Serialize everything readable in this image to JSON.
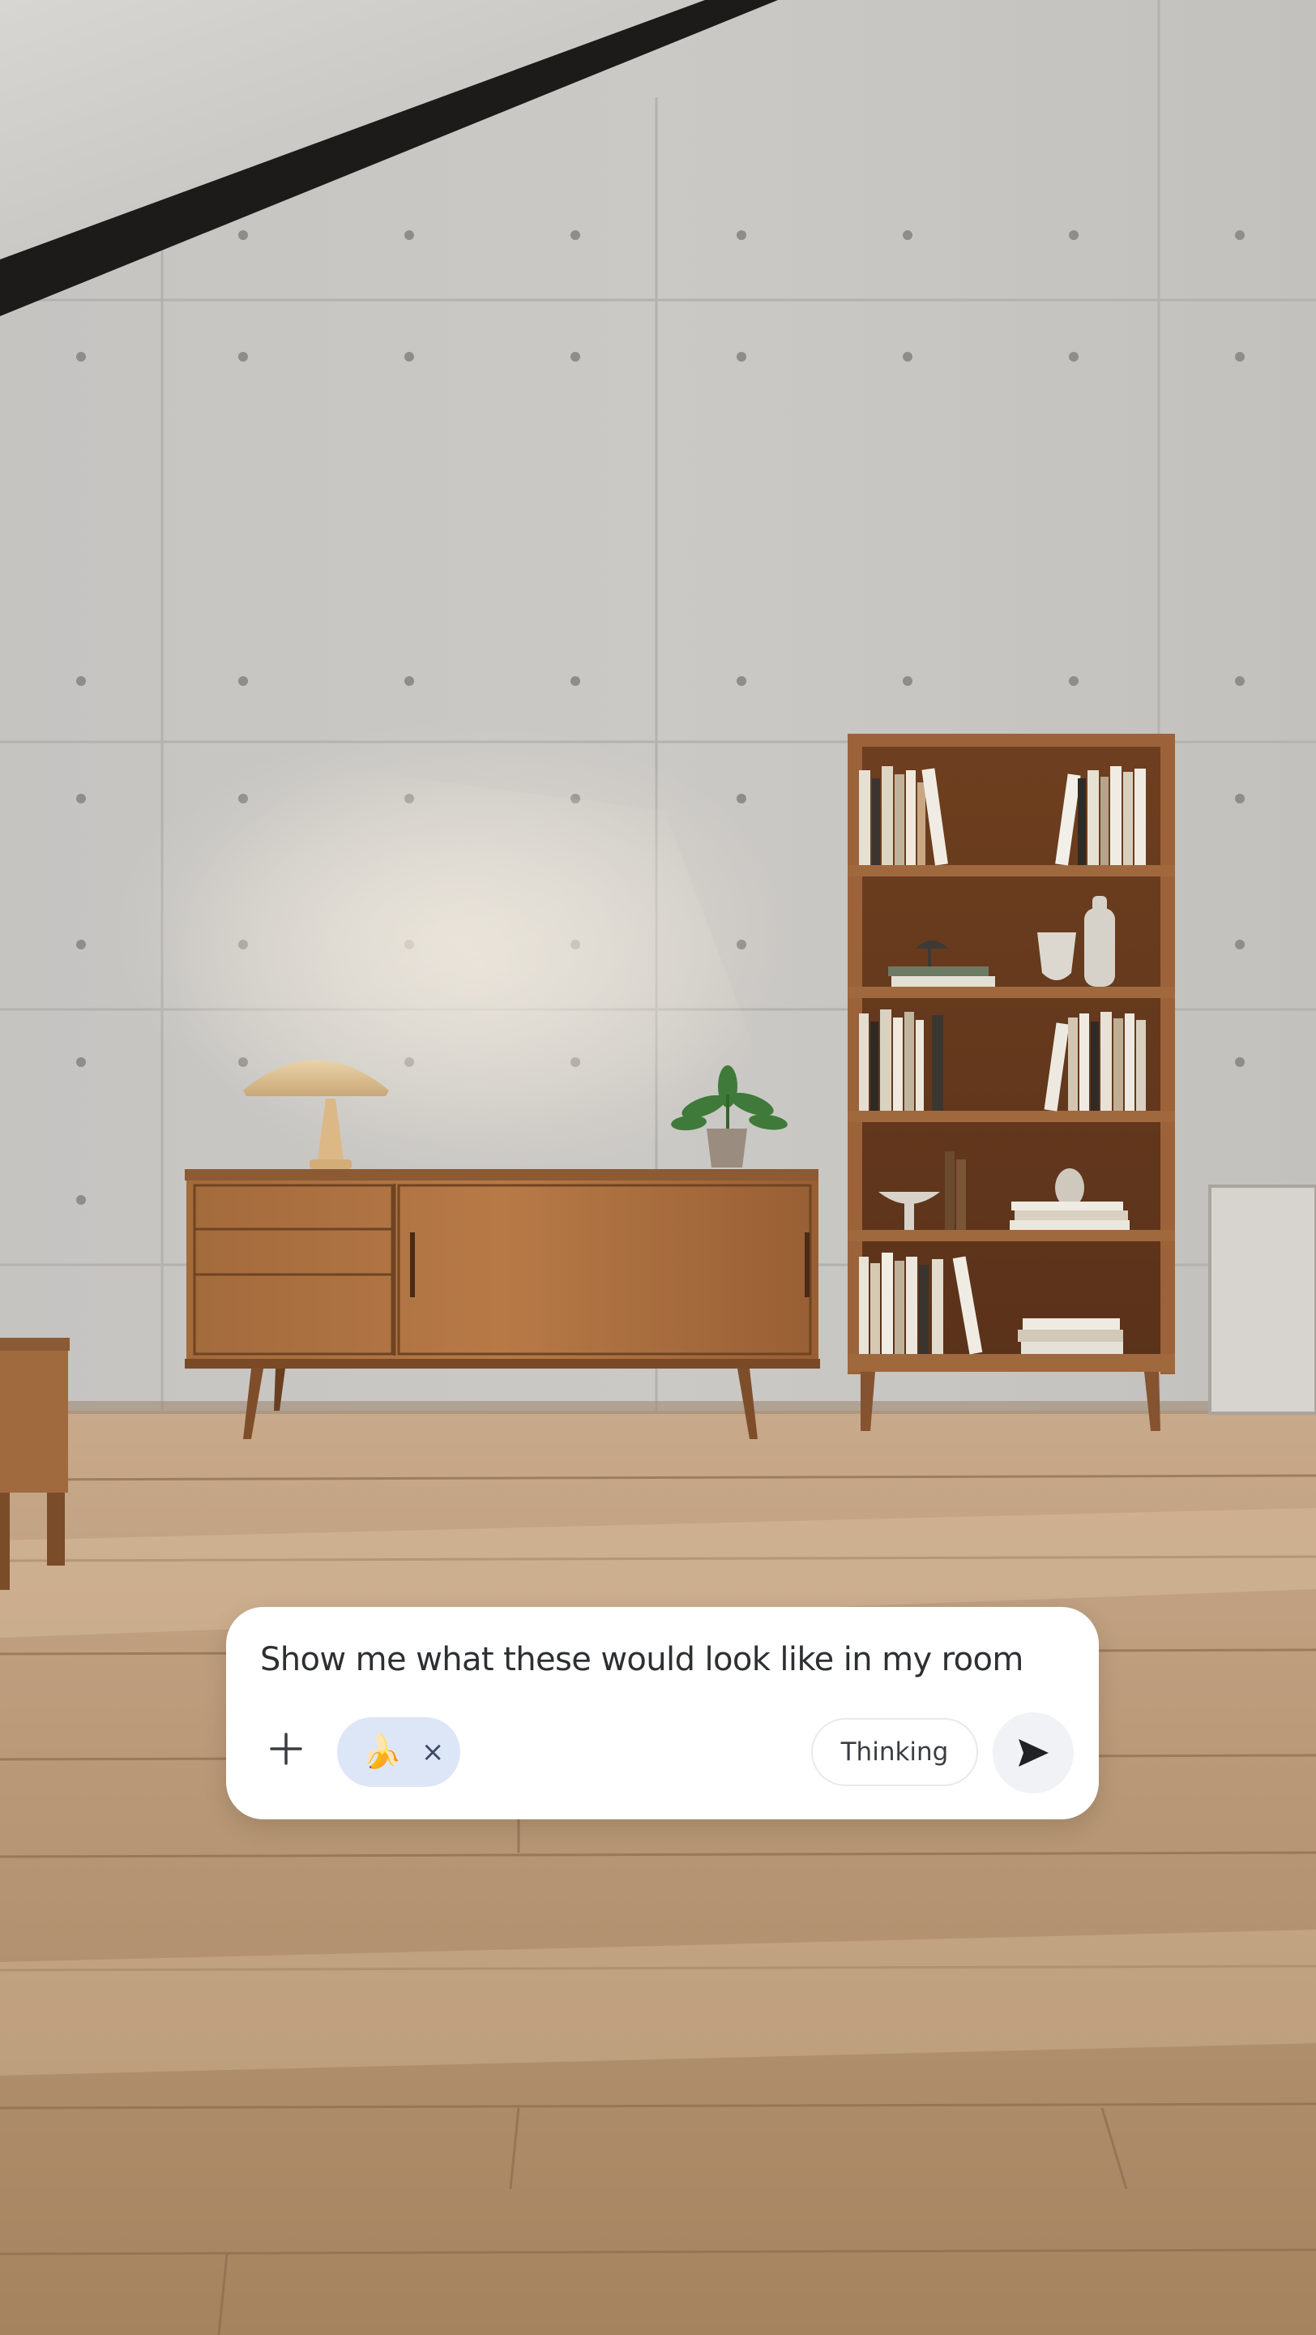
{
  "composer": {
    "prompt": "Show me what these would look like in my room",
    "attachment_emoji": "🍌",
    "attachment_remove": "×",
    "thinking_label": "Thinking"
  },
  "icons": {
    "add": "plus-icon",
    "send": "send-arrow-icon",
    "remove": "close-icon"
  }
}
